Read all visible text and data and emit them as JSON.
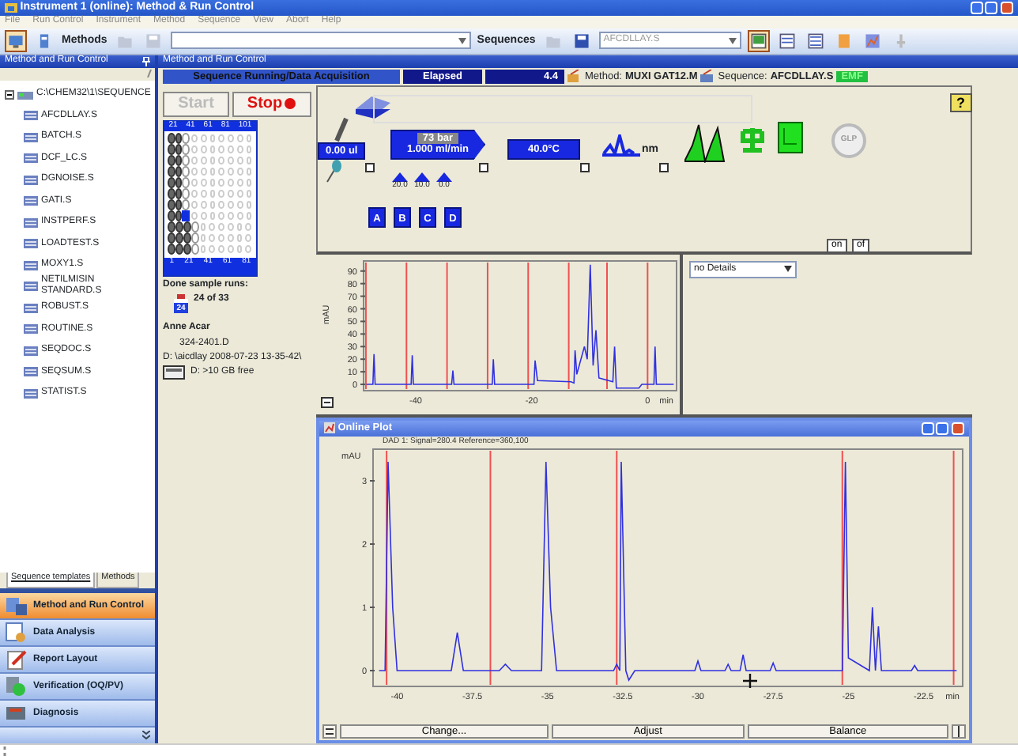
{
  "window": {
    "title": "Instrument 1 (online): Method & Run Control"
  },
  "menu": [
    "File",
    "Run Control",
    "Instrument",
    "Method",
    "Sequence",
    "View",
    "Abort",
    "Help"
  ],
  "toolbar": {
    "methods_label": "Methods",
    "sequences_label": "Sequences",
    "sequence_value": "AFCDLLAY.S"
  },
  "left_panel": {
    "title": "Method and Run Control",
    "tree": {
      "label": "C:\\CHEM32\\1\\SEQUENCE",
      "expanded": true,
      "children": [
        {
          "label": "AFCDLLAY.S"
        },
        {
          "label": "BATCH.S"
        },
        {
          "label": "DCF_LC.S"
        },
        {
          "label": "DGNOISE.S"
        },
        {
          "label": "GATI.S"
        },
        {
          "label": "INSTPERF.S"
        },
        {
          "label": "LOADTEST.S"
        },
        {
          "label": "MOXY1.S"
        },
        {
          "label": "NETILMISIN STANDARD.S"
        },
        {
          "label": "ROBUST.S"
        },
        {
          "label": "ROUTINE.S"
        },
        {
          "label": "SEQDOC.S"
        },
        {
          "label": "SEQSUM.S"
        },
        {
          "label": "STATIST.S"
        }
      ]
    },
    "tabs": [
      {
        "label": "Sequence templates",
        "selected": true
      },
      {
        "label": "Methods",
        "selected": false
      }
    ],
    "nav": [
      {
        "label": "Method and Run Control",
        "selected": true
      },
      {
        "label": "Data Analysis",
        "selected": false
      },
      {
        "label": "Report Layout",
        "selected": false
      },
      {
        "label": "Verification (OQ/PV)",
        "selected": false
      },
      {
        "label": "Diagnosis",
        "selected": false
      }
    ]
  },
  "main": {
    "title": "Method and Run Control",
    "status": {
      "state": "Sequence Running/Data Acquisition",
      "elapsed_label": "Elapsed",
      "elapsed": "4.4",
      "method_label": "Method:",
      "method": "MUXI GAT12.M",
      "sequence_label": "Sequence:",
      "sequence": "AFCDLLAY.S",
      "flag": "EMF"
    },
    "run": {
      "start": "Start",
      "stop": "Stop",
      "tray": {
        "top_labels": [
          "21",
          "41",
          "61",
          "81",
          "101"
        ],
        "bottom_labels": [
          "1",
          "21",
          "41",
          "61",
          "81"
        ],
        "rows": [
          [
            {
              "kind": "done"
            },
            {
              "kind": "done"
            },
            {
              "kind": "pending"
            },
            {
              "kind": "empty"
            },
            {
              "kind": "empty"
            },
            {
              "kind": "empty"
            },
            {
              "kind": "empty"
            },
            {
              "kind": "empty"
            },
            {
              "kind": "empty"
            },
            {
              "kind": "empty"
            }
          ],
          [
            {
              "kind": "done"
            },
            {
              "kind": "done"
            },
            {
              "kind": "pending"
            },
            {
              "kind": "empty"
            },
            {
              "kind": "empty"
            },
            {
              "kind": "empty"
            },
            {
              "kind": "empty"
            },
            {
              "kind": "empty"
            },
            {
              "kind": "empty"
            },
            {
              "kind": "empty"
            }
          ],
          [
            {
              "kind": "done"
            },
            {
              "kind": "done"
            },
            {
              "kind": "pending"
            },
            {
              "kind": "empty"
            },
            {
              "kind": "empty"
            },
            {
              "kind": "empty"
            },
            {
              "kind": "empty"
            },
            {
              "kind": "empty"
            },
            {
              "kind": "empty"
            },
            {
              "kind": "empty"
            }
          ],
          [
            {
              "kind": "done"
            },
            {
              "kind": "done"
            },
            {
              "kind": "pending"
            },
            {
              "kind": "empty"
            },
            {
              "kind": "empty"
            },
            {
              "kind": "empty"
            },
            {
              "kind": "empty"
            },
            {
              "kind": "empty"
            },
            {
              "kind": "empty"
            },
            {
              "kind": "empty"
            }
          ],
          [
            {
              "kind": "done"
            },
            {
              "kind": "done"
            },
            {
              "kind": "pending"
            },
            {
              "kind": "empty"
            },
            {
              "kind": "empty"
            },
            {
              "kind": "empty"
            },
            {
              "kind": "empty"
            },
            {
              "kind": "empty"
            },
            {
              "kind": "empty"
            },
            {
              "kind": "empty"
            }
          ],
          [
            {
              "kind": "done"
            },
            {
              "kind": "done"
            },
            {
              "kind": "pending"
            },
            {
              "kind": "empty"
            },
            {
              "kind": "empty"
            },
            {
              "kind": "empty"
            },
            {
              "kind": "empty"
            },
            {
              "kind": "empty"
            },
            {
              "kind": "empty"
            },
            {
              "kind": "empty"
            }
          ],
          [
            {
              "kind": "done"
            },
            {
              "kind": "done"
            },
            {
              "kind": "pending"
            },
            {
              "kind": "empty"
            },
            {
              "kind": "empty"
            },
            {
              "kind": "empty"
            },
            {
              "kind": "empty"
            },
            {
              "kind": "empty"
            },
            {
              "kind": "empty"
            },
            {
              "kind": "empty"
            }
          ],
          [
            {
              "kind": "done"
            },
            {
              "kind": "done"
            },
            {
              "kind": "current"
            },
            {
              "kind": "empty"
            },
            {
              "kind": "empty"
            },
            {
              "kind": "empty"
            },
            {
              "kind": "empty"
            },
            {
              "kind": "empty"
            },
            {
              "kind": "empty"
            },
            {
              "kind": "empty"
            }
          ],
          [
            {
              "kind": "done"
            },
            {
              "kind": "done"
            },
            {
              "kind": "done"
            },
            {
              "kind": "pending"
            },
            {
              "kind": "empty"
            },
            {
              "kind": "empty"
            },
            {
              "kind": "empty"
            },
            {
              "kind": "empty"
            },
            {
              "kind": "empty"
            },
            {
              "kind": "empty"
            }
          ],
          [
            {
              "kind": "done"
            },
            {
              "kind": "done"
            },
            {
              "kind": "done"
            },
            {
              "kind": "pending"
            },
            {
              "kind": "empty"
            },
            {
              "kind": "empty"
            },
            {
              "kind": "empty"
            },
            {
              "kind": "empty"
            },
            {
              "kind": "empty"
            },
            {
              "kind": "empty"
            }
          ],
          [
            {
              "kind": "done"
            },
            {
              "kind": "done"
            },
            {
              "kind": "done"
            },
            {
              "kind": "pending"
            },
            {
              "kind": "empty"
            },
            {
              "kind": "empty"
            },
            {
              "kind": "empty"
            },
            {
              "kind": "empty"
            },
            {
              "kind": "empty"
            },
            {
              "kind": "empty"
            }
          ]
        ]
      },
      "done_label": "Done sample runs:",
      "done": "24 of 33",
      "vial": "24",
      "operator": "Anne Acar",
      "file": "324-2401.D",
      "path": "D: \\aicdlay 2008-07-23 13-35-42\\",
      "disk": "D: >10 GB free"
    },
    "instrument": {
      "injector": "0.00 ul",
      "pressure": "73 bar",
      "flow": "1.000 ml/min",
      "solvent_levels": [
        "20.0",
        "10.0",
        "0.0"
      ],
      "bottles": [
        "A",
        "B",
        "C",
        "D"
      ],
      "column_temp": "40.0°C",
      "detector": "nm",
      "glp": "GLP",
      "help": "?",
      "on": "on",
      "off": "of"
    },
    "trend": {
      "chart_data": {
        "type": "line",
        "xlabel": "min",
        "ylabel": "mAU",
        "xlim": [
          -49,
          5
        ],
        "ylim": [
          -5,
          98
        ],
        "xticks": [
          -40,
          -20,
          0
        ],
        "yticks": [
          0,
          10,
          20,
          30,
          40,
          50,
          60,
          70,
          80,
          90
        ],
        "x": [
          -48.5,
          -47.4,
          -47.2,
          -47,
          -40.8,
          -40.6,
          -40.4,
          -33.8,
          -33.6,
          -33.4,
          -26.8,
          -26.6,
          -26.4,
          -19.6,
          -19.4,
          -19,
          -13.2,
          -12.7,
          -12.5,
          -12.2,
          -10.9,
          -10.4,
          -9.9,
          -9.4,
          -8.9,
          -8.4,
          -6,
          -5.7,
          -5.4,
          -1.5,
          -1,
          1.1,
          1.3,
          1.5,
          4.5
        ],
        "series": [
          {
            "color": "#3030e0",
            "values": [
              0,
              0,
              24,
              0,
              0,
              23,
              0,
              0,
              11,
              0,
              0,
              20,
              0,
              0,
              19,
              3,
              2,
              1,
              27,
              8,
              30,
              20,
              95,
              15,
              43,
              5,
              2,
              30,
              -3,
              -3,
              0,
              0,
              30,
              0,
              0
            ]
          }
        ],
        "ref_lines": [
          {
            "axis": "x",
            "value": -48.6
          },
          {
            "axis": "x",
            "value": -41.6
          },
          {
            "axis": "x",
            "value": -34.6
          },
          {
            "axis": "x",
            "value": -27.6
          },
          {
            "axis": "x",
            "value": -20.6
          },
          {
            "axis": "x",
            "value": -13.6
          },
          {
            "axis": "x",
            "value": -7
          },
          {
            "axis": "x",
            "value": 0
          }
        ]
      }
    },
    "details": {
      "value": "no Details"
    },
    "online_plot": {
      "title": "Online Plot",
      "signal": "DAD 1: Signal=280.4 Reference=360,100",
      "buttons": [
        "Change...",
        "Adjust",
        "Balance"
      ],
      "chart_data": {
        "type": "line",
        "xlabel": "min",
        "ylabel": "mAU",
        "xlim": [
          -40.8,
          -21.2
        ],
        "ylim": [
          -0.25,
          3.5
        ],
        "xticks": [
          -40,
          -37.5,
          -35,
          -32.5,
          -30,
          -27.5,
          -25,
          -22.5
        ],
        "yticks": [
          0,
          1,
          2,
          3
        ],
        "x": [
          -40.6,
          -40.4,
          -40.3,
          -40.15,
          -40,
          -38.2,
          -38,
          -37.8,
          -36.6,
          -36.4,
          -36.2,
          -35.2,
          -35.05,
          -34.9,
          -34.7,
          -32.8,
          -32.7,
          -32.6,
          -32.55,
          -32.4,
          -32.3,
          -32.1,
          -30.1,
          -30,
          -29.9,
          -29.1,
          -29,
          -28.9,
          -28.6,
          -28.5,
          -28.4,
          -27.6,
          -27.5,
          -27.4,
          -25.2,
          -25.1,
          -25,
          -24.3,
          -24.2,
          -24.1,
          -24,
          -23.9,
          -22.9,
          -22.8,
          -22.7,
          -21.4
        ],
        "series": [
          {
            "color": "#3030e0",
            "values": [
              0,
              0,
              3.3,
              1,
              0,
              0,
              0.6,
              0,
              0,
              0.1,
              0,
              0,
              3.3,
              1,
              0,
              0,
              0.1,
              0,
              3.3,
              0,
              -0.15,
              0,
              0,
              0.15,
              0,
              0,
              0.1,
              0,
              0,
              0.25,
              0,
              0,
              0.12,
              0,
              0,
              3.3,
              0.2,
              0,
              1,
              0,
              0.7,
              0,
              0,
              0.08,
              0,
              0
            ]
          }
        ],
        "ref_lines": [
          {
            "axis": "x",
            "value": -40.35
          },
          {
            "axis": "x",
            "value": -36.9
          },
          {
            "axis": "x",
            "value": -32.7
          },
          {
            "axis": "x",
            "value": -25.2
          },
          {
            "axis": "x",
            "value": -21.5
          }
        ]
      }
    }
  }
}
